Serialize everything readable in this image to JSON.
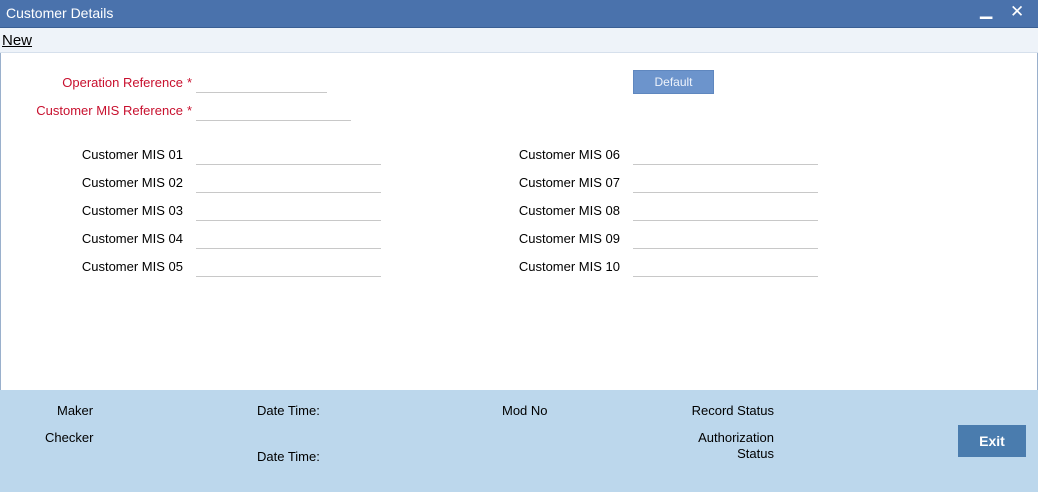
{
  "window": {
    "title": "Customer Details",
    "minimize_glyph": "▁",
    "close_glyph": "✕"
  },
  "menu": {
    "new_label": "New"
  },
  "form": {
    "operation_reference": {
      "label": "Operation Reference",
      "required_mark": "*",
      "value": ""
    },
    "customer_mis_reference": {
      "label": "Customer MIS Reference",
      "required_mark": "*",
      "value": ""
    },
    "default_button": "Default",
    "mis_left": [
      {
        "label": "Customer MIS 01",
        "value": ""
      },
      {
        "label": "Customer MIS 02",
        "value": ""
      },
      {
        "label": "Customer MIS 03",
        "value": ""
      },
      {
        "label": "Customer MIS 04",
        "value": ""
      },
      {
        "label": "Customer MIS 05",
        "value": ""
      }
    ],
    "mis_right": [
      {
        "label": "Customer MIS 06",
        "value": ""
      },
      {
        "label": "Customer MIS 07",
        "value": ""
      },
      {
        "label": "Customer MIS 08",
        "value": ""
      },
      {
        "label": "Customer MIS 09",
        "value": ""
      },
      {
        "label": "Customer MIS 10",
        "value": ""
      }
    ]
  },
  "footer": {
    "maker": "Maker",
    "checker": "Checker",
    "date_time_1": "Date Time:",
    "date_time_2": "Date Time:",
    "mod_no": "Mod No",
    "record_status": "Record Status",
    "authorization_status_line1": "Authorization",
    "authorization_status_line2": "Status",
    "exit_button": "Exit"
  },
  "colors": {
    "titlebar": "#4a72ac",
    "required_label": "#c8102e",
    "footer_bg": "#bcd7ec",
    "exit_button": "#4a7cae",
    "default_button": "#6c94cc"
  }
}
